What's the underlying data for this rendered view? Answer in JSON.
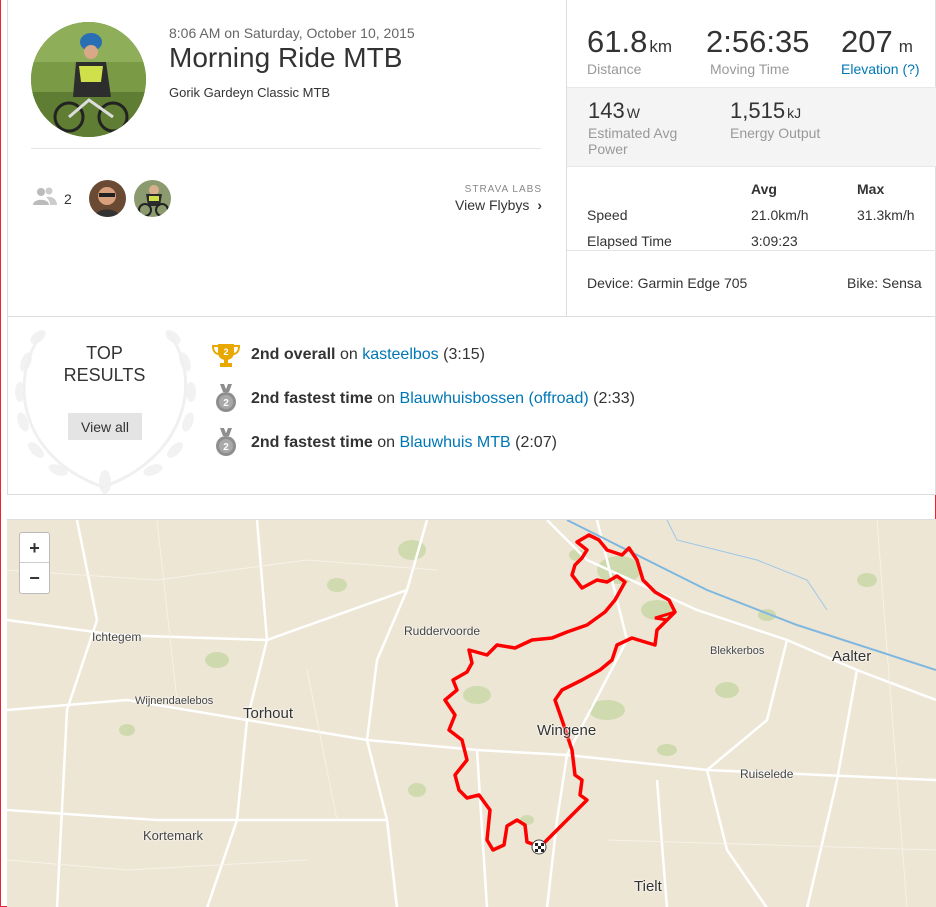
{
  "activity": {
    "datetime": "8:06 AM on Saturday, October 10, 2015",
    "title": "Morning Ride MTB",
    "subtitle": "Gorik Gardeyn Classic MTB"
  },
  "social": {
    "kudos_count": "2",
    "strava_labs": "STRAVA LABS",
    "view_flybys": "View Flybys"
  },
  "stats": {
    "distance": {
      "value": "61.8",
      "unit": "km",
      "label": "Distance"
    },
    "moving_time": {
      "value": "2:56:35",
      "label": "Moving Time"
    },
    "elevation": {
      "value": "207",
      "unit": "m",
      "label": "Elevation (?)"
    },
    "power": {
      "value": "143",
      "unit": "W",
      "label": "Estimated Avg Power"
    },
    "energy": {
      "value": "1,515",
      "unit": "kJ",
      "label": "Energy Output"
    }
  },
  "table": {
    "avg_header": "Avg",
    "max_header": "Max",
    "rows": [
      {
        "label": "Speed",
        "avg": "21.0km/h",
        "max": "31.3km/h"
      },
      {
        "label": "Elapsed Time",
        "avg": "3:09:23",
        "max": ""
      }
    ]
  },
  "device": "Device: Garmin Edge 705",
  "bike": "Bike: Sensa",
  "top_results": {
    "title_line1": "TOP",
    "title_line2": "RESULTS",
    "view_all": "View all",
    "items": [
      {
        "rank_text": "2nd overall",
        "on": "on",
        "segment": "kasteelbos",
        "time": "(3:15)",
        "icon": "trophy-icon",
        "badge": "2"
      },
      {
        "rank_text": "2nd fastest time",
        "on": "on",
        "segment": "Blauwhuisbossen (offroad)",
        "time": "(2:33)",
        "icon": "medal-icon",
        "badge": "2"
      },
      {
        "rank_text": "2nd fastest time",
        "on": "on",
        "segment": "Blauwhuis MTB",
        "time": "(2:07)",
        "icon": "medal-icon",
        "badge": "2"
      }
    ]
  },
  "map": {
    "zoom_in": "+",
    "zoom_out": "−",
    "towns": {
      "ruddervoorde": "Ruddervoorde",
      "ichtegem": "Ichtegem",
      "wijnendaelebos": "Wijnendaelebos",
      "torhout": "Torhout",
      "kortemark": "Kortemark",
      "wingene": "Wingene",
      "blekkerbos": "Blekkerbos",
      "aalter": "Aalter",
      "ruiselede": "Ruiselede",
      "tielt": "Tielt"
    }
  },
  "colors": {
    "link": "#0077b5",
    "route": "#ff0000",
    "gold": "#e8a800",
    "silver": "#8e8e8e"
  }
}
